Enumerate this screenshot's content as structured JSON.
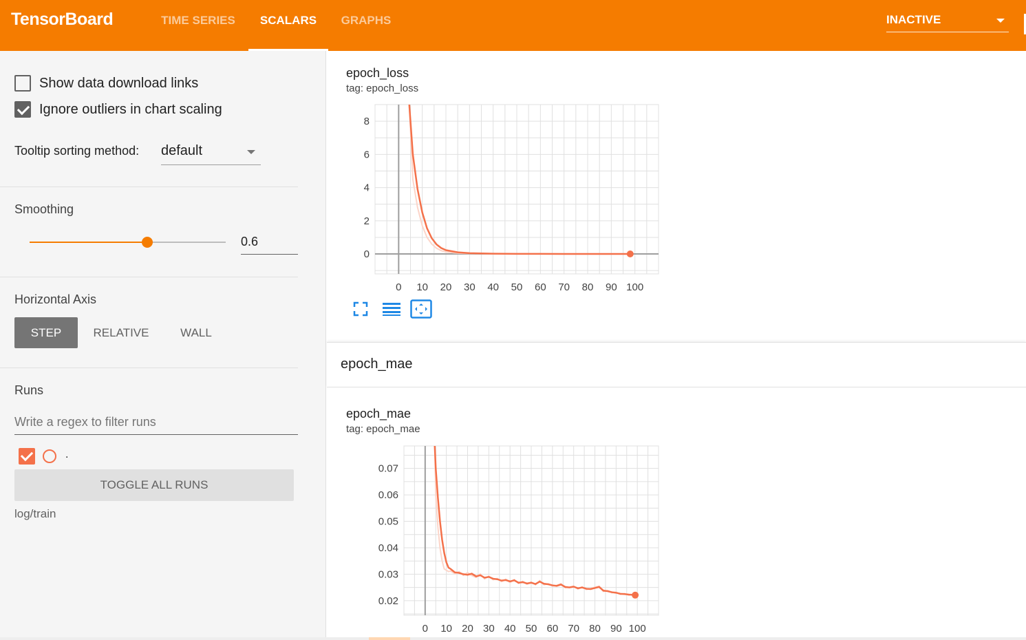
{
  "app": {
    "title": "TensorBoard"
  },
  "tabs": [
    {
      "label": "TIME SERIES",
      "active": false
    },
    {
      "label": "SCALARS",
      "active": true
    },
    {
      "label": "GRAPHS",
      "active": false
    }
  ],
  "status_select": {
    "value": "INACTIVE"
  },
  "sidebar": {
    "show_download_links": {
      "label": "Show data download links",
      "checked": false
    },
    "ignore_outliers": {
      "label": "Ignore outliers in chart scaling",
      "checked": true
    },
    "tooltip_sorting": {
      "label": "Tooltip sorting method:",
      "value": "default"
    },
    "smoothing": {
      "label": "Smoothing",
      "value": "0.6",
      "fraction": 0.6
    },
    "horizontal_axis": {
      "label": "Horizontal Axis",
      "options": [
        {
          "label": "STEP",
          "active": true
        },
        {
          "label": "RELATIVE",
          "active": false
        },
        {
          "label": "WALL",
          "active": false
        }
      ]
    },
    "runs": {
      "label": "Runs",
      "filter_placeholder": "Write a regex to filter runs",
      "items": [
        {
          "name": ".",
          "checked": true,
          "color": "#f4714a"
        }
      ],
      "toggle_label": "TOGGLE ALL RUNS",
      "path": "log/train"
    }
  },
  "colors": {
    "accent": "#f57c00",
    "series": "#f4714a",
    "series_faint": "#fcd5c9",
    "tool_icon": "#1e88e5"
  },
  "main": {
    "group_title": "epoch_mae",
    "tool_icons": [
      "fullscreen-icon",
      "toggle-log-scale-icon",
      "fit-domain-icon"
    ]
  },
  "chart_data": [
    {
      "type": "line",
      "title": "epoch_loss",
      "subtitle": "tag: epoch_loss",
      "xlim": [
        -10,
        110
      ],
      "ylim": [
        -1.2,
        9
      ],
      "x_ticks": [
        0,
        10,
        20,
        30,
        40,
        50,
        60,
        70,
        80,
        90,
        100
      ],
      "y_ticks": [
        0,
        2,
        4,
        6,
        8
      ],
      "y_tick_labels": [
        "0",
        "2",
        "4",
        "6",
        "8"
      ],
      "grid": true,
      "series": [
        {
          "x": [
            4.5,
            6,
            8,
            10,
            12,
            14,
            16,
            18,
            20,
            25,
            30,
            40,
            50,
            60,
            70,
            80,
            90,
            98
          ],
          "smoothed": [
            9,
            6.0,
            3.9,
            2.5,
            1.55,
            0.95,
            0.58,
            0.36,
            0.23,
            0.1,
            0.05,
            0.02,
            0.01,
            0.006,
            0.004,
            0.003,
            0.002,
            0.002
          ],
          "raw": [
            9,
            4.5,
            2.8,
            1.7,
            1.0,
            0.6,
            0.35,
            0.2,
            0.12,
            0.05,
            0.03,
            0.01,
            0.006,
            0.004,
            0.003,
            0.002,
            0.002,
            0.002
          ],
          "last": [
            98,
            0.002
          ]
        }
      ]
    },
    {
      "type": "line",
      "title": "epoch_mae",
      "subtitle": "tag: epoch_mae",
      "xlim": [
        -10,
        110
      ],
      "ylim": [
        0.0145,
        0.0785
      ],
      "x_ticks": [
        0,
        10,
        20,
        30,
        40,
        50,
        60,
        70,
        80,
        90,
        100
      ],
      "y_ticks": [
        0.02,
        0.03,
        0.04,
        0.05,
        0.06,
        0.07
      ],
      "y_tick_labels": [
        "0.02",
        "0.03",
        "0.04",
        "0.05",
        "0.06",
        "0.07"
      ],
      "grid": true,
      "series": [
        {
          "x": [
            4.5,
            5,
            6,
            7,
            8,
            9,
            10,
            11,
            12,
            14,
            16,
            18,
            20,
            22,
            24,
            26,
            28,
            30,
            32,
            34,
            36,
            38,
            40,
            42,
            44,
            46,
            48,
            50,
            52,
            54,
            56,
            58,
            60,
            62,
            64,
            66,
            68,
            70,
            72,
            74,
            76,
            78,
            80,
            82,
            84,
            86,
            88,
            90,
            92,
            94,
            96,
            98,
            99
          ],
          "smoothed": [
            0.079,
            0.07,
            0.059,
            0.05,
            0.043,
            0.038,
            0.0345,
            0.0325,
            0.032,
            0.0307,
            0.0305,
            0.03,
            0.0298,
            0.0302,
            0.0292,
            0.0296,
            0.0287,
            0.029,
            0.0283,
            0.0281,
            0.0276,
            0.0278,
            0.0273,
            0.0277,
            0.0268,
            0.027,
            0.0265,
            0.0268,
            0.0263,
            0.0272,
            0.0264,
            0.0262,
            0.0258,
            0.0256,
            0.0261,
            0.0252,
            0.025,
            0.0253,
            0.0247,
            0.025,
            0.0245,
            0.0244,
            0.0248,
            0.0252,
            0.0238,
            0.0236,
            0.0232,
            0.023,
            0.0226,
            0.0225,
            0.0223,
            0.0222,
            0.0221
          ],
          "raw": [
            0.079,
            0.06,
            0.048,
            0.04,
            0.035,
            0.032,
            0.0315,
            0.031,
            0.0312,
            0.0302,
            0.031,
            0.0296,
            0.0306,
            0.0295,
            0.0288,
            0.0301,
            0.0282,
            0.0293,
            0.0279,
            0.0284,
            0.0272,
            0.0281,
            0.0269,
            0.028,
            0.0265,
            0.0273,
            0.0262,
            0.027,
            0.026,
            0.0276,
            0.026,
            0.0264,
            0.0255,
            0.0258,
            0.0264,
            0.0249,
            0.0251,
            0.0255,
            0.0244,
            0.0252,
            0.0242,
            0.0246,
            0.0251,
            0.0255,
            0.0235,
            0.0238,
            0.023,
            0.0232,
            0.0224,
            0.0227,
            0.0221,
            0.0224,
            0.0221
          ],
          "last": [
            99,
            0.0221
          ]
        }
      ]
    }
  ]
}
